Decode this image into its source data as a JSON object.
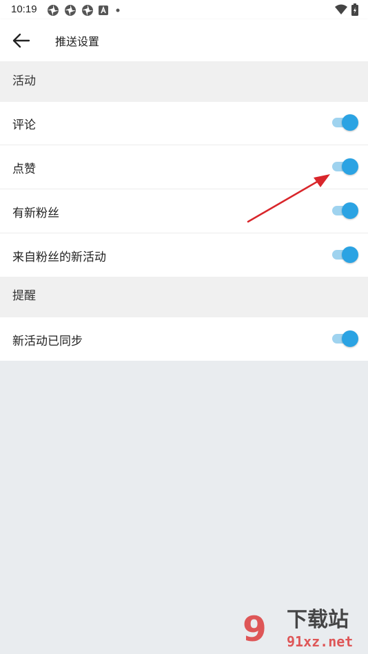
{
  "status_bar": {
    "time": "10:19",
    "icons": [
      "pinwheel-icon",
      "pinwheel-icon",
      "pinwheel-icon",
      "a-badge-icon",
      "dot-icon"
    ],
    "right_icons": [
      "wifi-icon",
      "battery-icon"
    ]
  },
  "header": {
    "title": "推送设置",
    "back_icon": "arrow-left-icon"
  },
  "sections": [
    {
      "title": "活动",
      "items": [
        {
          "label": "评论",
          "enabled": true
        },
        {
          "label": "点赞",
          "enabled": true
        },
        {
          "label": "有新粉丝",
          "enabled": true
        },
        {
          "label": "来自粉丝的新活动",
          "enabled": true
        }
      ]
    },
    {
      "title": "提醒",
      "items": [
        {
          "label": "新活动已同步",
          "enabled": true
        }
      ]
    }
  ],
  "colors": {
    "toggle_knob": "#2ba3e3",
    "toggle_track": "#9fd3ef",
    "section_bg": "#f0f0f0",
    "page_bg": "#e9ecef",
    "annotation_arrow": "#d9262b"
  },
  "watermark": {
    "number": "9",
    "text": "下载站",
    "domain": "91xz.net"
  }
}
